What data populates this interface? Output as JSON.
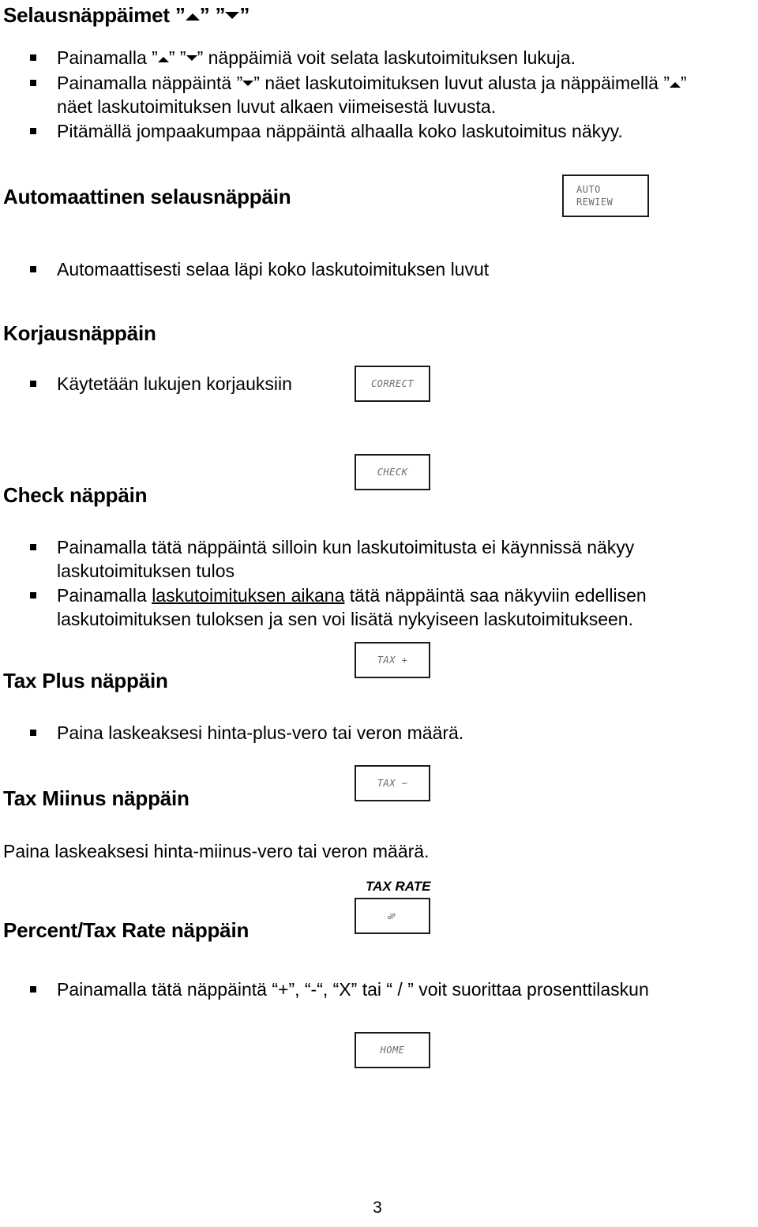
{
  "document": {
    "page_number": "3",
    "language": "fi"
  },
  "sections": {
    "browse_keys": {
      "heading_prefix": "Selausnäppäimet ",
      "heading_quote_open": "”",
      "heading_quote_close": "”",
      "bullets": [
        {
          "prefix": "Painamalla ”",
          "mid": "” ”",
          "suffix": "” näppäimiä voit selata laskutoimituksen lukuja."
        },
        {
          "part1": "Painamalla näppäintä ”",
          "part2": "” näet laskutoimituksen luvut alusta ja näppäimellä ”",
          "part3": "”",
          "line2": "näet laskutoimituksen luvut alkaen viimeisestä luvusta."
        },
        {
          "text": "Pitämällä jompaakumpaa näppäintä alhaalla koko laskutoimitus näkyy."
        }
      ]
    },
    "auto_review": {
      "heading": "Automaattinen selausnäppäin",
      "key_label": "AUTO\nREWIEW",
      "bullet": "Automaattisesti selaa läpi koko laskutoimituksen luvut"
    },
    "correct": {
      "heading": "Korjausnäppäin",
      "bullet": "Käytetään lukujen korjauksiin",
      "key_label": "CORRECT"
    },
    "check": {
      "heading": "Check näppäin",
      "key_label": "CHECK",
      "bullets": [
        {
          "line1": "Painamalla tätä näppäintä silloin kun laskutoimitusta ei käynnissä näkyy",
          "line2": "laskutoimituksen tulos"
        },
        {
          "pre": "Painamalla ",
          "underlined": "laskutoimituksen aikana",
          "post": " tätä näppäintä saa näkyviin edellisen",
          "line2": "laskutoimituksen tuloksen ja sen voi lisätä nykyiseen laskutoimitukseen."
        }
      ]
    },
    "tax_plus": {
      "heading": "Tax Plus näppäin",
      "key_label": "TAX +",
      "bullet": "Paina laskeaksesi hinta-plus-vero tai veron määrä."
    },
    "tax_minus": {
      "heading": "Tax Miinus näppäin",
      "key_label": "TAX −",
      "text": "Paina laskeaksesi hinta-miinus-vero tai veron määrä."
    },
    "percent_tax_rate": {
      "heading": "Percent/Tax Rate näppäin",
      "key_top_label": "TAX RATE",
      "key_label": "%",
      "bullet": "Painamalla tätä näppäintä “+”, “-“, “X” tai “ / ” voit suorittaa prosenttilaskun"
    },
    "home": {
      "key_label": "HOME"
    }
  },
  "colors": {
    "text": "#000000",
    "key_border": "#1a1a1a",
    "key_label": "#6b6b6b",
    "background": "#ffffff"
  }
}
